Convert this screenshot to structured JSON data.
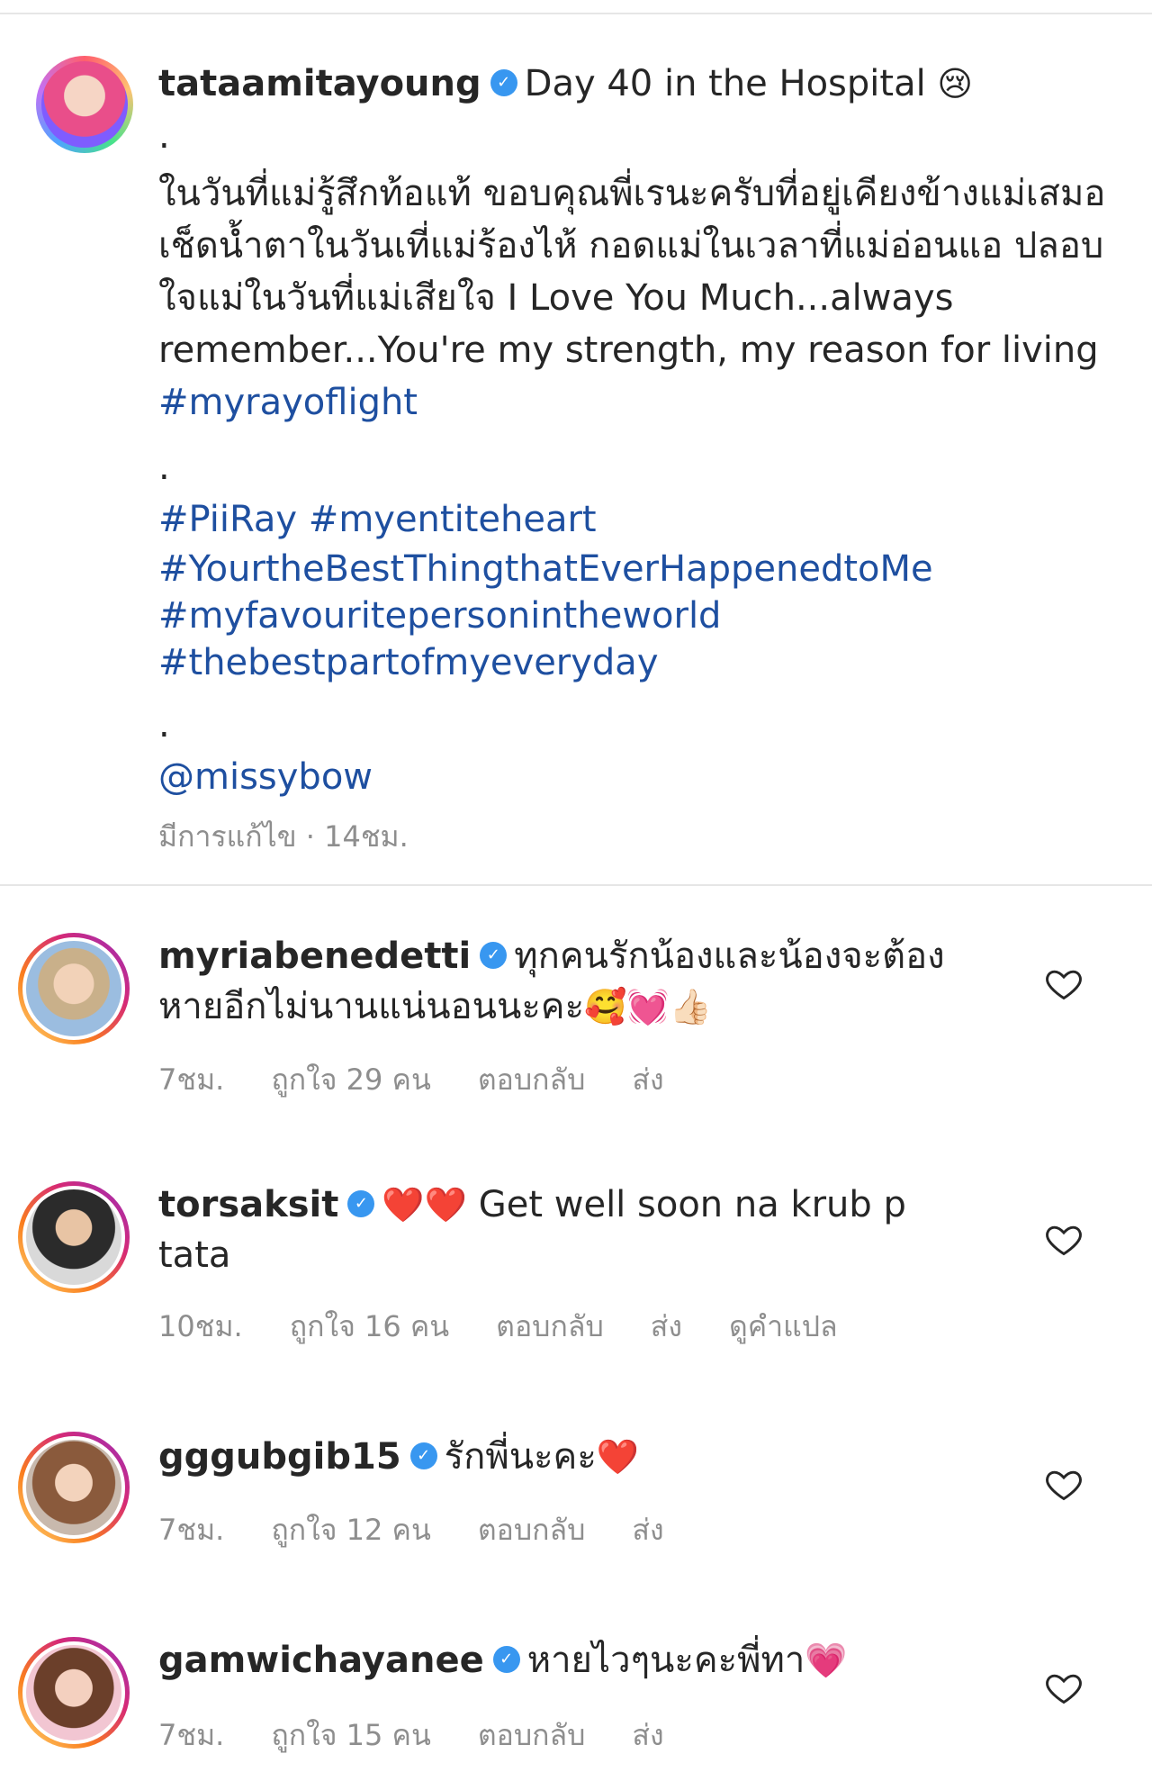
{
  "post": {
    "username": "tataamitayoung",
    "title": "Day 40 in the Hospital",
    "title_emoji": "😢",
    "dot1": ".",
    "body_thai": "ในวันที่แม่รู้สึกท้อแท้ ขอบคุณพี่เรนะครับที่อยู่เคียงข้างแม่เสมอ เช็ดน้ำตาในวันเที่แม่ร้องไห้ กอดแม่ในเวลาที่แม่อ่อนแอ ปลอบใจแม่ในวันที่แม่เสียใจ I Love You Much...always remember...You're my strength, my reason for living",
    "body_hashtag": "#myrayoflight",
    "dot2": ".",
    "hashtags": [
      "#PiiRay #myentiteheart",
      "#YourtheBestThingthatEverHappenedtoMe",
      "#myfavouritepersonintheworld",
      "#thebestpartofmyeveryday"
    ],
    "dot3": ".",
    "mention": "@missybow",
    "meta": "มีการแก้ไข · 14ชม."
  },
  "comments": [
    {
      "username": "myriabenedetti",
      "text": "ทุกคนรักน้องและน้องจะต้องหายอีกไม่นานแน่นอนนะคะ",
      "emojis": "🥰💓👍🏻",
      "time": "7ชม.",
      "likes": "ถูกใจ 29 คน",
      "reply": "ตอบกลับ",
      "send": "ส่ง",
      "translate": ""
    },
    {
      "username": "torsaksit",
      "text": "Get well soon na krub p tata",
      "emojis": "❤️❤️",
      "time": "10ชม.",
      "likes": "ถูกใจ 16 คน",
      "reply": "ตอบกลับ",
      "send": "ส่ง",
      "translate": "ดูคำแปล"
    },
    {
      "username": "gggubgib15",
      "text": "รักพี่นะคะ",
      "emojis": "❤️",
      "time": "7ชม.",
      "likes": "ถูกใจ 12 คน",
      "reply": "ตอบกลับ",
      "send": "ส่ง",
      "translate": ""
    },
    {
      "username": "gamwichayanee",
      "text": "หายไวๆนะคะพี่ทา",
      "emojis": "💗",
      "time": "7ชม.",
      "likes": "ถูกใจ 15 คน",
      "reply": "ตอบกลับ",
      "send": "ส่ง",
      "translate": ""
    }
  ],
  "verified_glyph": "✓",
  "colors": {
    "link": "#1e4fa0",
    "meta": "#8e8e8e",
    "verified": "#3897f0"
  }
}
